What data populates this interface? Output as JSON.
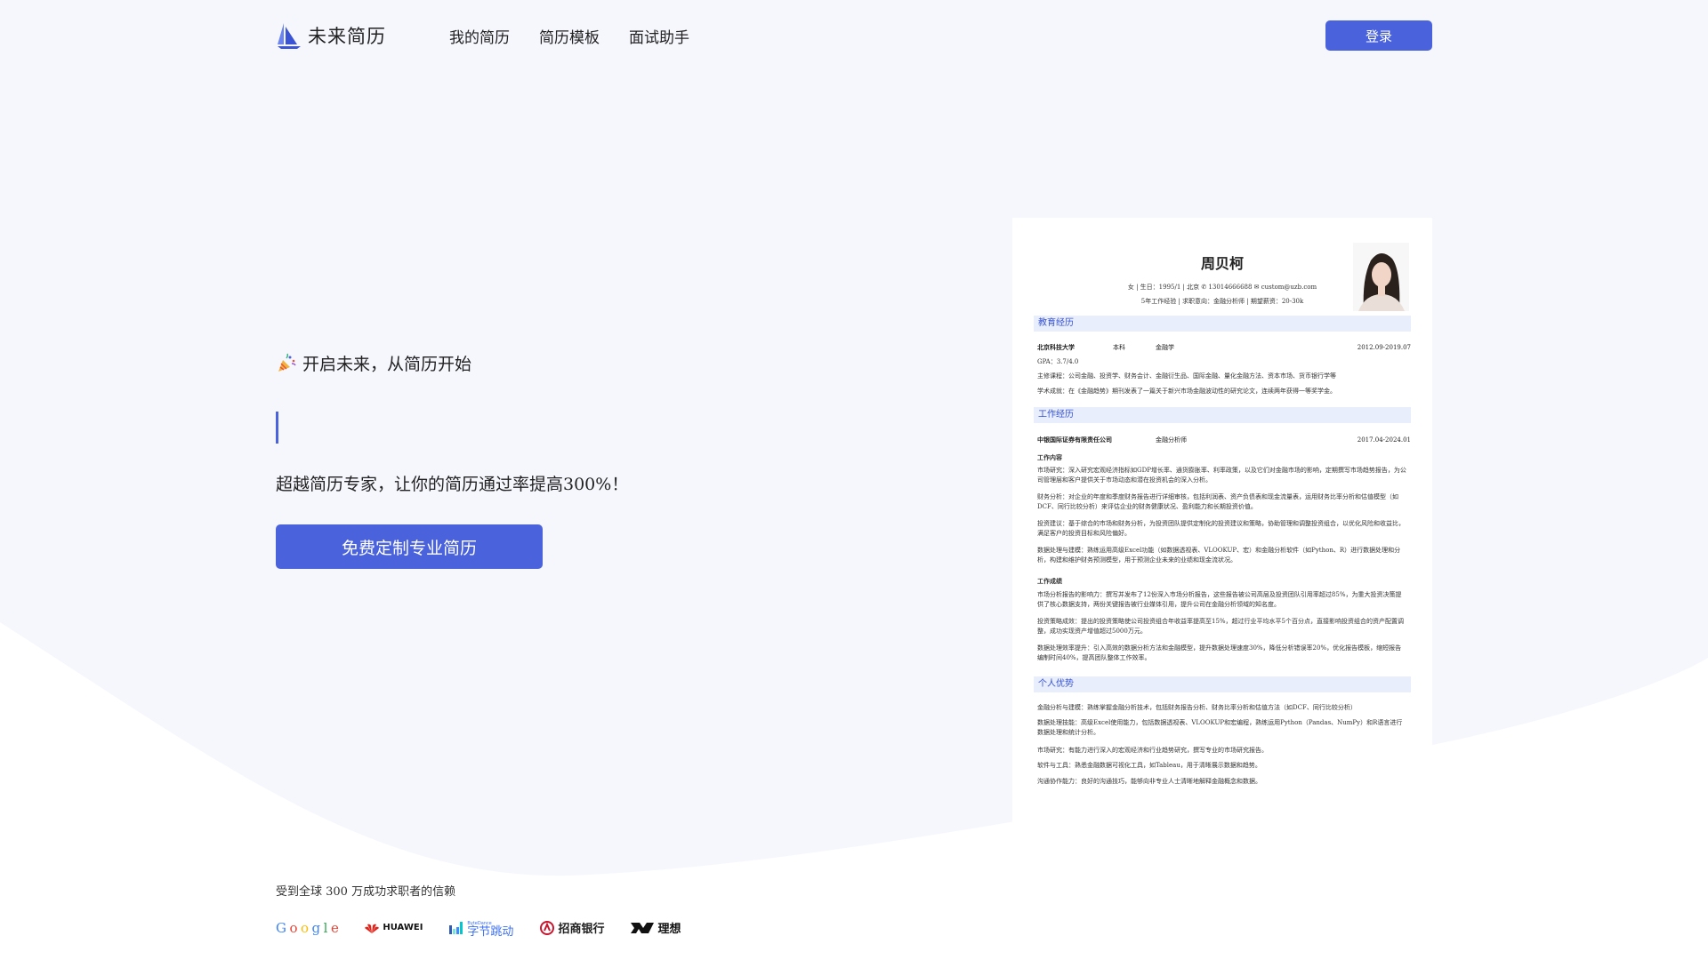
{
  "nav": {
    "brand": "未来简历",
    "links": [
      "我的简历",
      "简历模板",
      "面试助手"
    ],
    "login": "登录"
  },
  "hero": {
    "tagline": "开启未来，从简历开始",
    "subtitle": "超越简历专家，让你的简历通过率提高300%！",
    "cta": "免费定制专业简历"
  },
  "trust": {
    "text": "受到全球 300 万成功求职者的信赖",
    "logos": {
      "google": [
        "G",
        "o",
        "o",
        "g",
        "l",
        "e"
      ],
      "huawei": "HUAWEI",
      "bytedance_small": "ByteDance",
      "bytedance": "字节跳动",
      "cmb": "招商银行",
      "lixiang": "理想"
    }
  },
  "resume": {
    "name": "周贝柯",
    "info_line1": "女 | 生日：1995/1 | 北京 ✆ 13014666688 ✉ custom@uzb.com",
    "info_line2": "5年工作经验 | 求职意向：金融分析师 | 期望薪资：20-30k",
    "sections": {
      "education": "教育经历",
      "work": "工作经历",
      "strengths": "个人优势"
    },
    "education": {
      "school": "北京科技大学",
      "degree": "本科",
      "major": "金融学",
      "date": "2012.09-2019.07",
      "gpa": "GPA：3.7/4.0",
      "courses": "主修课程：公司金融、投资学、财务会计、金融衍生品、国际金融、量化金融方法、资本市场、货币银行学等",
      "achievements": "学术成就：在《金融趋势》期刊发表了一篇关于新兴市场金融波动性的研究论文，连续两年获得一等奖学金。"
    },
    "work": {
      "company": "中银国际证券有限责任公司",
      "title": "金融分析师",
      "date": "2017.04-2024.01",
      "content_label": "工作内容",
      "items": [
        "市场研究：深入研究宏观经济指标如GDP增长率、通货膨胀率、利率政策，以及它们对金融市场的影响，定期撰写市场趋势报告，为公司管理层和客户提供关于市场动态和潜在投资机会的深入分析。",
        "财务分析：对企业的年度和季度财务报告进行详细审核，包括利润表、资产负债表和现金流量表，运用财务比率分析和估值模型（如DCF、同行比较分析）来评估企业的财务健康状况、盈利能力和长期投资价值。",
        "投资建议：基于综合的市场和财务分析，为投资团队提供定制化的投资建议和策略，协助管理和调整投资组合，以优化风险和收益比，满足客户的投资目标和风险偏好。",
        "数据处理与建模：熟练运用高级Excel功能（如数据透视表、VLOOKUP、宏）和金融分析软件（如Python、R）进行数据处理和分析，构建和维护财务预测模型，用于预测企业未来的业绩和现金流状况。"
      ],
      "results_label": "工作成绩",
      "results": [
        "市场分析报告的影响力：撰写并发布了12份深入市场分析报告，这些报告被公司高层及投资团队引用率超过85%，为重大投资决策提供了核心数据支持，两份关键报告被行业媒体引用，提升公司在金融分析领域的知名度。",
        "投资策略成效：提出的投资策略使公司投资组合年收益率提高至15%，超过行业平均水平5个百分点，直接影响投资组合的资产配置调整，成功实现资产增值超过5000万元。",
        "数据处理效率提升：引入高效的数据分析方法和金融模型，提升数据处理速度30%，降低分析错误率20%，优化报告模板，缩短报告编制时间40%，提高团队整体工作效率。"
      ]
    },
    "strengths": [
      "金融分析与建模：熟练掌握金融分析技术，包括财务报告分析、财务比率分析和估值方法（如DCF、同行比较分析）",
      "数据处理技能：高级Excel使用能力，包括数据透视表、VLOOKUP和宏编程，熟练运用Python（Pandas、NumPy）和R语言进行数据处理和统计分析。",
      "市场研究：有能力进行深入的宏观经济和行业趋势研究，撰写专业的市场研究报告。",
      "软件与工具：熟悉金融数据可视化工具，如Tableau，用于清晰展示数据和趋势。",
      "沟通协作能力：良好的沟通技巧，能够向非专业人士清晰地解释金融概念和数据。"
    ]
  },
  "colors": {
    "accent": "#4a62db",
    "background": "#f6f7fd",
    "section_bg": "#e9eefc"
  }
}
